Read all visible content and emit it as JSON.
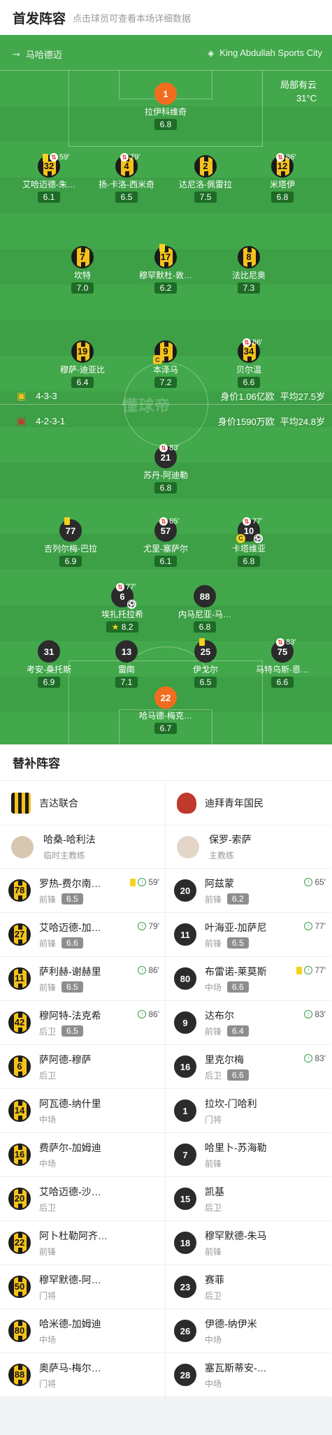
{
  "header": {
    "title": "首发阵容",
    "subtitle": "点击球员可查看本场详细数据"
  },
  "venue": {
    "city": "马哈德迈",
    "stadium": "King Abdullah Sports City"
  },
  "weather": {
    "condition": "局部有云",
    "temp": "31°C"
  },
  "watermark": "懂球帝",
  "home_formation": {
    "formation": "4-3-3",
    "value": "身价1.06亿欧",
    "age": "平均27.5岁"
  },
  "away_formation": {
    "formation": "4-2-3-1",
    "value": "身价1590万欧",
    "age": "平均24.8岁"
  },
  "home_players": [
    {
      "num": "1",
      "name": "拉伊科维奇",
      "rating": "6.8",
      "gk": true
    },
    {
      "num": "32",
      "name": "艾哈迈德-朱…",
      "rating": "6.1",
      "yellow": true,
      "sub": "59'"
    },
    {
      "num": "4",
      "name": "扬-卡洛-西米奇",
      "rating": "6.5",
      "sub": "79'"
    },
    {
      "num": "2",
      "name": "达尼洛-佩雷拉",
      "rating": "7.5"
    },
    {
      "num": "12",
      "name": "米塔伊",
      "rating": "6.8",
      "sub": "86'"
    },
    {
      "num": "7",
      "name": "坎特",
      "rating": "7.0"
    },
    {
      "num": "17",
      "name": "穆罕默杜-敦…",
      "rating": "6.2",
      "yellow": true
    },
    {
      "num": "8",
      "name": "法比尼奥",
      "rating": "7.3"
    },
    {
      "num": "19",
      "name": "穆萨-迪亚比",
      "rating": "6.4"
    },
    {
      "num": "9",
      "name": "本泽马",
      "rating": "7.2",
      "captain": "C"
    },
    {
      "num": "34",
      "name": "贝尔温",
      "rating": "6.6",
      "sub": "86'"
    }
  ],
  "away_players": [
    {
      "num": "21",
      "name": "苏丹-阿迪勒",
      "rating": "6.8",
      "sub": "83'"
    },
    {
      "num": "77",
      "name": "吉列尔梅-巴拉",
      "rating": "6.9",
      "yellow": true
    },
    {
      "num": "57",
      "name": "尤里-塞萨尔",
      "rating": "6.1",
      "sub": "65'"
    },
    {
      "num": "10",
      "name": "卡塔维亚",
      "rating": "6.8",
      "sub": "77'",
      "captain": "C",
      "goal": "⚽"
    },
    {
      "num": "6",
      "name": "埃扎托拉希",
      "rating": "8.2",
      "sub": "77'",
      "best": "★",
      "goal": "⚽"
    },
    {
      "num": "88",
      "name": "内马尼亚-马…",
      "rating": "6.8"
    },
    {
      "num": "31",
      "name": "考安-桑托斯",
      "rating": "6.9"
    },
    {
      "num": "13",
      "name": "雷南",
      "rating": "7.1"
    },
    {
      "num": "25",
      "name": "伊戈尔",
      "rating": "6.5",
      "yellow": true
    },
    {
      "num": "75",
      "name": "马特乌斯-恩…",
      "rating": "6.6",
      "sub": "83'"
    },
    {
      "num": "22",
      "name": "哈马德-梅克…",
      "rating": "6.7",
      "gk": true
    }
  ],
  "bench": {
    "title": "替补阵容",
    "home": {
      "team": "吉达联合",
      "coach": "哈桑-哈利法",
      "coach_role": "临时主教练",
      "players": [
        {
          "num": "78",
          "name": "罗热-费尔南…",
          "pos": "前锋",
          "rating": "6.5",
          "yellow": true,
          "min": "59'"
        },
        {
          "num": "27",
          "name": "艾哈迈德-加…",
          "pos": "前锋",
          "rating": "6.6",
          "min": "79'"
        },
        {
          "num": "11",
          "name": "萨利赫-谢赫里",
          "pos": "前锋",
          "rating": "6.5",
          "min": "86'"
        },
        {
          "num": "42",
          "name": "穆阿特-法克希",
          "pos": "后卫",
          "rating": "6.5",
          "min": "86'"
        },
        {
          "num": "6",
          "name": "萨阿德-穆萨",
          "pos": "后卫"
        },
        {
          "num": "14",
          "name": "阿瓦德-纳什里",
          "pos": "中场"
        },
        {
          "num": "16",
          "name": "费萨尔-加姆迪",
          "pos": "中场"
        },
        {
          "num": "20",
          "name": "艾哈迈德-沙…",
          "pos": "后卫"
        },
        {
          "num": "22",
          "name": "阿卜杜勒阿齐…",
          "pos": "前锋"
        },
        {
          "num": "50",
          "name": "穆罕默德-阿…",
          "pos": "门将"
        },
        {
          "num": "80",
          "name": "哈米德-加姆迪",
          "pos": "中场"
        },
        {
          "num": "88",
          "name": "奥萨马-梅尔…",
          "pos": "门将"
        }
      ]
    },
    "away": {
      "team": "迪拜青年国民",
      "coach": "保罗-索萨",
      "coach_role": "主教练",
      "players": [
        {
          "num": "20",
          "name": "阿兹蒙",
          "pos": "前锋",
          "rating": "6.2",
          "min": "65'"
        },
        {
          "num": "11",
          "name": "叶海亚-加萨尼",
          "pos": "前锋",
          "rating": "6.5",
          "min": "77'"
        },
        {
          "num": "80",
          "name": "布雷诺-莱莫斯",
          "pos": "中场",
          "rating": "6.6",
          "yellow": true,
          "min": "77'"
        },
        {
          "num": "9",
          "name": "达布尔",
          "pos": "前锋",
          "rating": "6.4",
          "min": "83'"
        },
        {
          "num": "16",
          "name": "里克尔梅",
          "pos": "后卫",
          "rating": "6.6",
          "min": "83'"
        },
        {
          "num": "1",
          "name": "拉坎-门哈利",
          "pos": "门将"
        },
        {
          "num": "7",
          "name": "哈里卜-苏海勒",
          "pos": "前锋"
        },
        {
          "num": "15",
          "name": "凯基",
          "pos": "后卫"
        },
        {
          "num": "18",
          "name": "穆罕默德-朱马",
          "pos": "前锋"
        },
        {
          "num": "23",
          "name": "赛菲",
          "pos": "后卫"
        },
        {
          "num": "26",
          "name": "伊德-纳伊米",
          "pos": "中场"
        },
        {
          "num": "28",
          "name": "塞瓦斯蒂安-…",
          "pos": "中场"
        }
      ]
    }
  }
}
